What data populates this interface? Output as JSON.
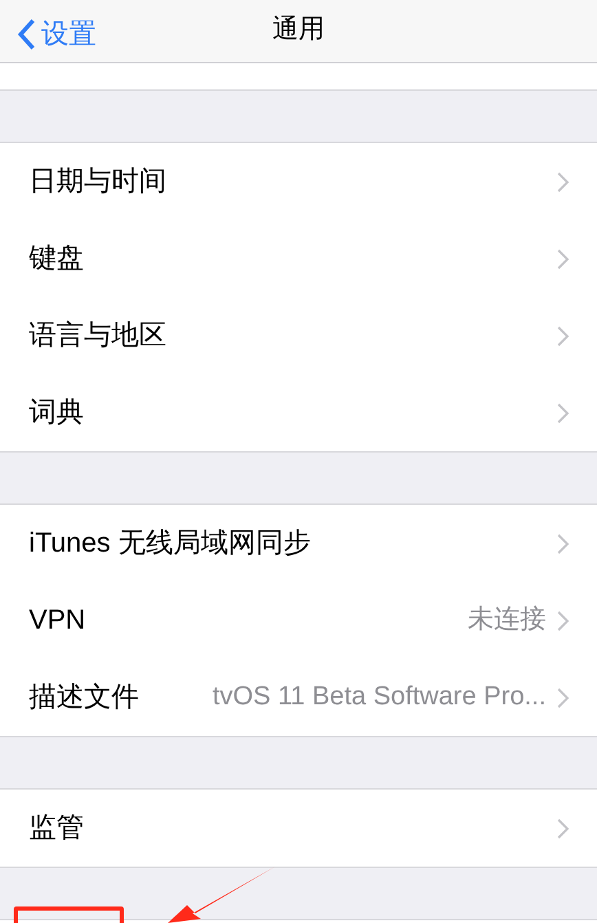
{
  "nav_bar": {
    "back": "设置",
    "title": "通用"
  },
  "groups": [
    {
      "rows": [
        {
          "label": "日期与时间"
        },
        {
          "label": "键盘"
        },
        {
          "label": "语言与地区"
        },
        {
          "label": "词典"
        }
      ]
    },
    {
      "rows": [
        {
          "label": "iTunes 无线局域网同步"
        },
        {
          "label": "VPN",
          "value": "未连接"
        },
        {
          "label": "描述文件",
          "value": "tvOS 11 Beta Software Pro..."
        }
      ]
    },
    {
      "rows": [
        {
          "label": "监管"
        }
      ]
    }
  ]
}
